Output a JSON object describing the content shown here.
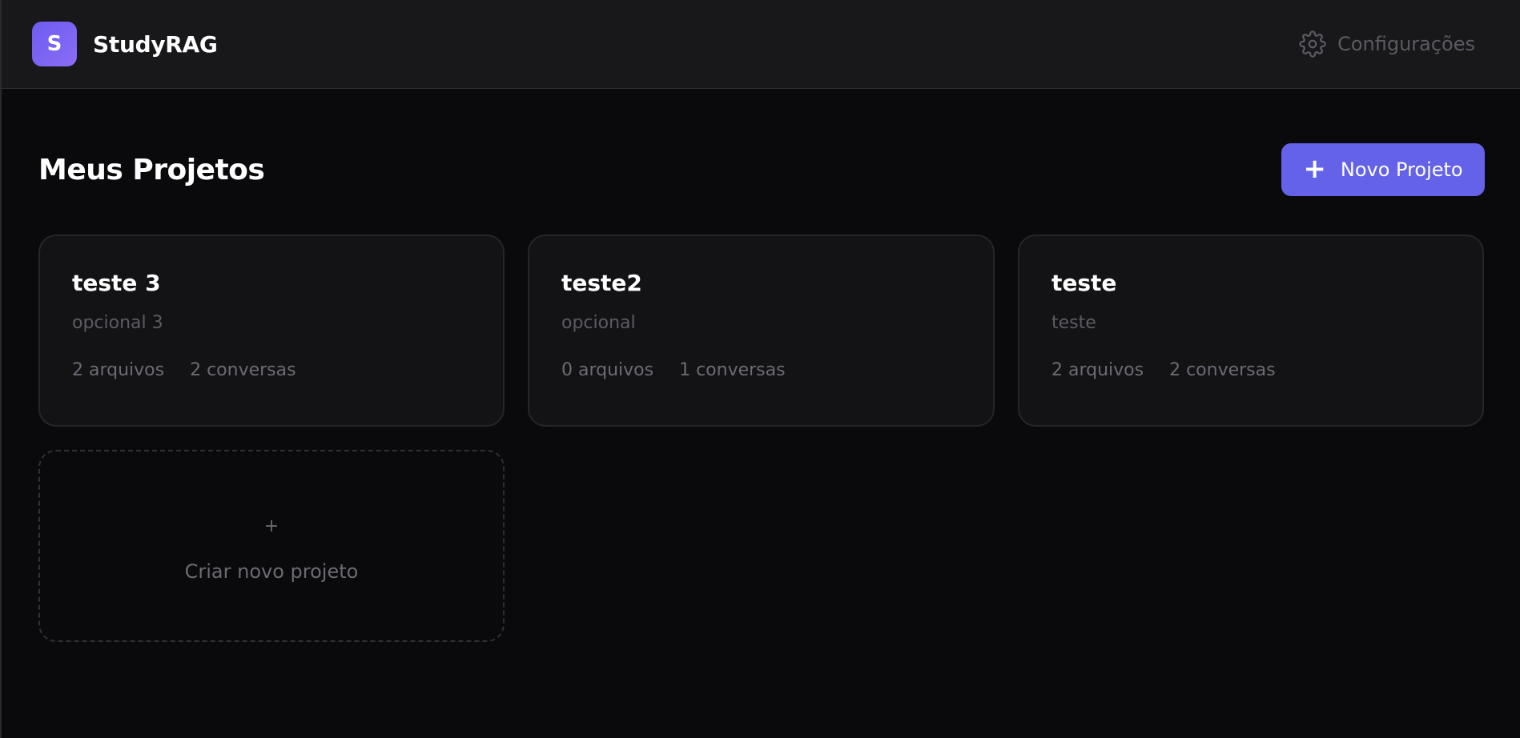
{
  "header": {
    "logo_letter": "S",
    "app_name": "StudyRAG",
    "settings_label": "Configurações",
    "settings_icon": "gear-icon"
  },
  "main": {
    "title": "Meus Projetos",
    "new_project_button": {
      "icon": "+",
      "label": "Novo Projeto"
    },
    "projects": [
      {
        "name": "teste 3",
        "description": "opcional 3",
        "files": "2 arquivos",
        "conversations": "2 conversas"
      },
      {
        "name": "teste2",
        "description": "opcional",
        "files": "0 arquivos",
        "conversations": "1 conversas"
      },
      {
        "name": "teste",
        "description": "teste",
        "files": "2 arquivos",
        "conversations": "2 conversas"
      }
    ],
    "create_card": {
      "icon": "+",
      "label": "Criar novo projeto"
    }
  },
  "colors": {
    "accent": "#6462e8",
    "background": "#0a0a0c",
    "header_bg": "#18181b",
    "card_bg": "#131316"
  }
}
